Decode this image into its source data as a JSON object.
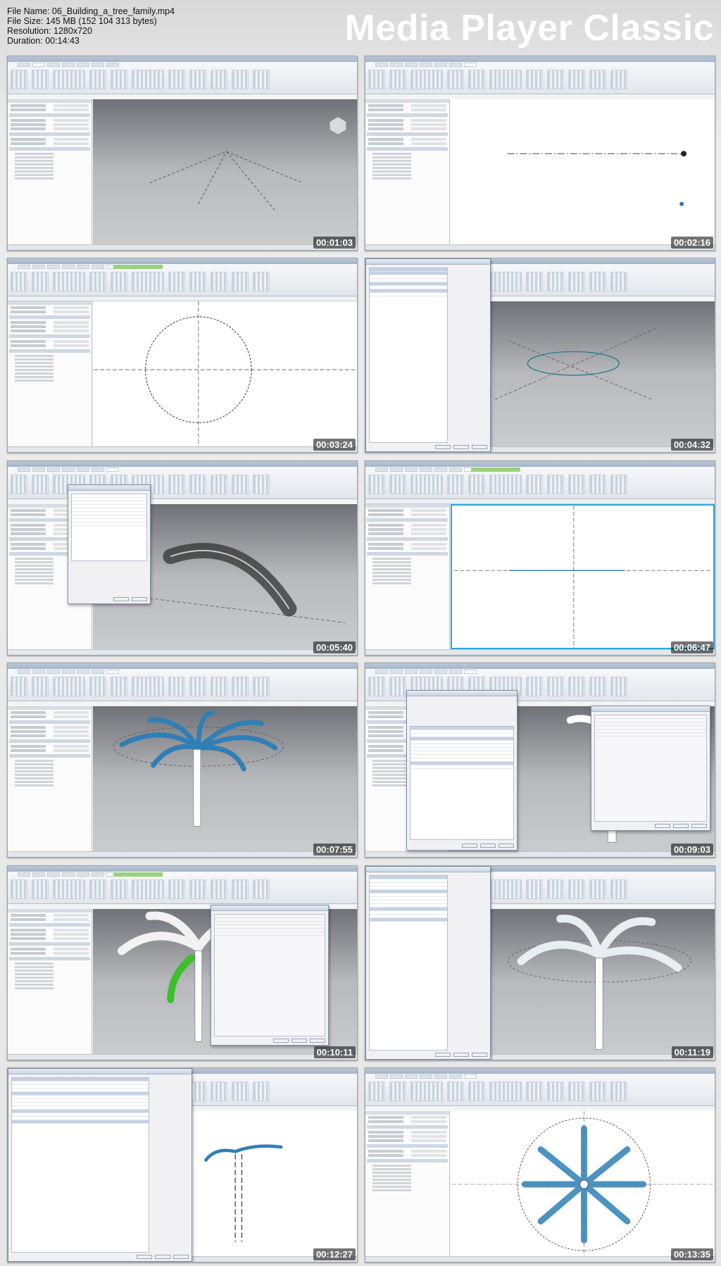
{
  "file_info": {
    "name_line": "File Name: 06_Building_a_tree_family.mp4",
    "size_line": "File Size: 145 MB (152 104 313 bytes)",
    "resolution_line": "Resolution: 1280x720",
    "duration_line": "Duration: 00:14:43"
  },
  "brand": "Media Player Classic",
  "thumbnails": [
    {
      "timestamp": "00:01:03"
    },
    {
      "timestamp": "00:02:16"
    },
    {
      "timestamp": "00:03:24"
    },
    {
      "timestamp": "00:04:32"
    },
    {
      "timestamp": "00:05:40"
    },
    {
      "timestamp": "00:06:47"
    },
    {
      "timestamp": "00:07:55"
    },
    {
      "timestamp": "00:09:03"
    },
    {
      "timestamp": "00:10:11"
    },
    {
      "timestamp": "00:11:19"
    },
    {
      "timestamp": "00:12:27"
    },
    {
      "timestamp": "00:13:35"
    }
  ],
  "colors": {
    "viewport_gray": "#9ea1a5",
    "frond_blue": "#2f7fb6",
    "selection_green": "#3bbf2a"
  },
  "icons": [
    "viewcube-icon",
    "tree-frond-icon"
  ]
}
